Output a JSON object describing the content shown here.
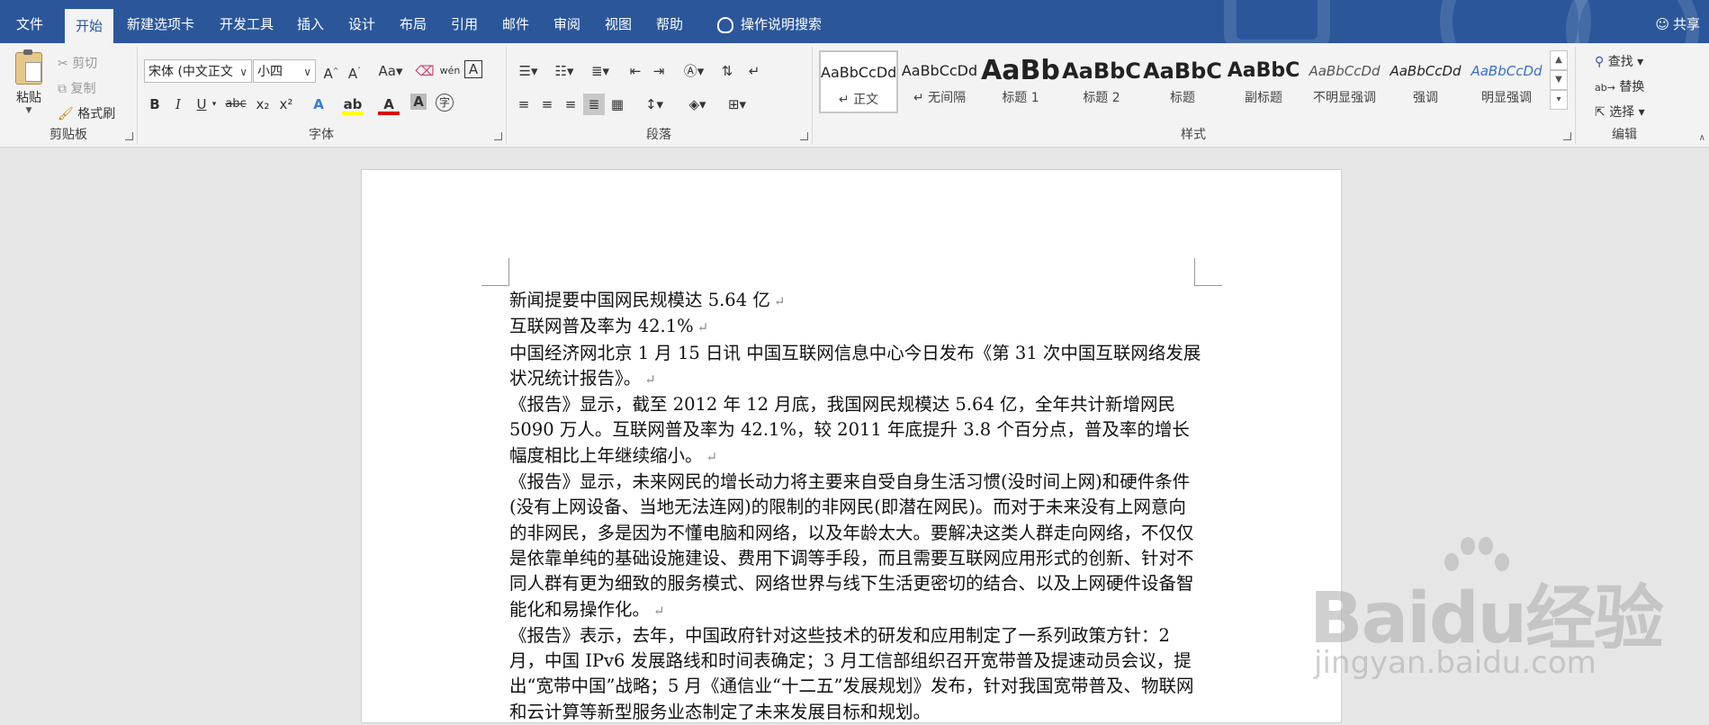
{
  "tabs": [
    {
      "label": "文件"
    },
    {
      "label": "开始"
    },
    {
      "label": "新建选项卡"
    },
    {
      "label": "开发工具"
    },
    {
      "label": "插入"
    },
    {
      "label": "设计"
    },
    {
      "label": "布局"
    },
    {
      "label": "引用"
    },
    {
      "label": "邮件"
    },
    {
      "label": "审阅"
    },
    {
      "label": "视图"
    },
    {
      "label": "帮助"
    }
  ],
  "tell_me": "操作说明搜索",
  "share": "共享",
  "clipboard": {
    "paste": "粘贴",
    "cut": "剪切",
    "copy": "复制",
    "format_painter": "格式刷",
    "label": "剪贴板"
  },
  "font": {
    "name": "宋体 (中文正文",
    "size": "小四",
    "label": "字体",
    "bold": "B",
    "italic": "I",
    "underline": "U",
    "strike": "abc",
    "sub": "x₂",
    "sup": "x²",
    "aa": "Aa",
    "grow": "A˄",
    "shrink": "A˅"
  },
  "paragraph": {
    "label": "段落"
  },
  "styles": {
    "label": "样式",
    "items": [
      {
        "preview": "AaBbCcDd",
        "name": "↵ 正文"
      },
      {
        "preview": "AaBbCcDd",
        "name": "↵ 无间隔"
      },
      {
        "preview": "AaBb",
        "name": "标题 1"
      },
      {
        "preview": "AaBbC",
        "name": "标题 2"
      },
      {
        "preview": "AaBbC",
        "name": "标题"
      },
      {
        "preview": "AaBbC",
        "name": "副标题"
      },
      {
        "preview": "AaBbCcDd",
        "name": "不明显强调"
      },
      {
        "preview": "AaBbCcDd",
        "name": "强调"
      },
      {
        "preview": "AaBbCcDd",
        "name": "明显强调"
      }
    ]
  },
  "editing": {
    "find": "查找",
    "replace": "替换",
    "select": "选择",
    "label": "编辑"
  },
  "document": {
    "paragraphs": [
      "新闻提要中国网民规模达 5.64 亿",
      "互联网普及率为 42.1%",
      "中国经济网北京 1 月 15 日讯  中国互联网信息中心今日发布《第 31 次中国互联网络发展状况统计报告》。",
      "《报告》显示，截至 2012 年 12 月底，我国网民规模达 5.64 亿，全年共计新增网民 5090 万人。互联网普及率为 42.1%，较 2011 年底提升 3.8 个百分点，普及率的增长幅度相比上年继续缩小。",
      "《报告》显示，未来网民的增长动力将主要来自受自身生活习惯(没时间上网)和硬件条件(没有上网设备、当地无法连网)的限制的非网民(即潜在网民)。而对于未来没有上网意向的非网民，多是因为不懂电脑和网络，以及年龄太大。要解决这类人群走向网络，不仅仅是依靠单纯的基础设施建设、费用下调等手段，而且需要互联网应用形式的创新、针对不同人群有更为细致的服务模式、网络世界与线下生活更密切的结合、以及上网硬件设备智能化和易操作化。",
      "《报告》表示，去年，中国政府针对这些技术的研发和应用制定了一系列政策方针：2 月，中国 IPv6 发展路线和时间表确定；3 月工信部组织召开宽带普及提速动员会议，提出“宽带中国”战略；5 月《通信业“十二五”发展规划》发布，针对我国宽带普及、物联网和云计算等新型服务业态制定了未来发展目标和规划。"
    ],
    "pilcrow": "↵"
  },
  "watermark": {
    "main": "Baidu经验",
    "sub": "jingyan.baidu.com"
  },
  "colors": {
    "accent": "#2b579a",
    "ribbon": "#f3f3f3",
    "workspace": "#e6e6e6"
  }
}
